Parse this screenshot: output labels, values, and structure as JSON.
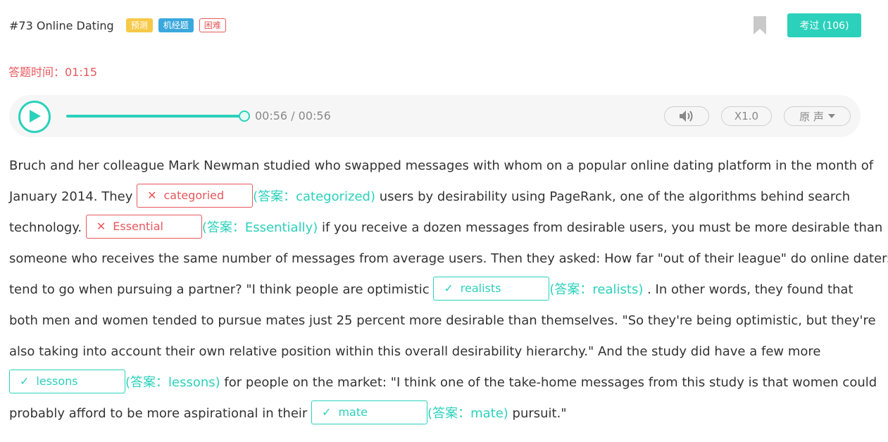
{
  "header": {
    "title": "#73 Online Dating",
    "tags": [
      "预测",
      "机经题",
      "困难"
    ],
    "exam_button": "考过 (106)"
  },
  "timer": {
    "label": "答题时间：01:15"
  },
  "player": {
    "time": "00:56 / 00:56",
    "progress": 1.0,
    "speed": "X1.0",
    "voice": "原 声"
  },
  "colors": {
    "accent": "#2bd1bb",
    "wrong": "#e8575d",
    "tag_yellow": "#f7c948",
    "tag_blue": "#3aa8dd"
  },
  "passage": {
    "l1": "Bruch and her colleague Mark Newman studied who swapped messages with whom on a popular online dating platform in the month of",
    "l2a": "January 2014. They",
    "b1": {
      "status": "wrong",
      "user": "categoried",
      "answer": "(答案：categorized)"
    },
    "l2b": "users by desirability using PageRank, one of the algorithms behind search",
    "l3a": "technology.",
    "b2": {
      "status": "wrong",
      "user": "Essential",
      "answer": "(答案：Essentially)"
    },
    "l3b": "if you receive a dozen messages from desirable users, you must be more desirable than",
    "l4": "someone who receives the same number of messages from average users. Then they asked: How far \"out of their league\" do online daters",
    "l5a": "tend to go when pursuing a partner? \"I think people are optimistic",
    "b3": {
      "status": "right",
      "user": "realists",
      "answer": "(答案：realists)"
    },
    "l5b": ". In other words, they found that",
    "l6": "both men and women tended to pursue mates just 25 percent more desirable than themselves. \"So they're being optimistic, but they're",
    "l7": "also taking into account their own relative position within this overall desirability hierarchy.\" And the study did have a few more",
    "b4": {
      "status": "right",
      "user": "lessons",
      "answer": "(答案：lessons)"
    },
    "l8b": "for people on the market: \"I think one of the take-home messages from this study is that women could",
    "l9a": "probably afford to be more aspirational in their",
    "b5": {
      "status": "right",
      "user": "mate",
      "answer": "(答案：mate)"
    },
    "l9b": "pursuit.\""
  }
}
